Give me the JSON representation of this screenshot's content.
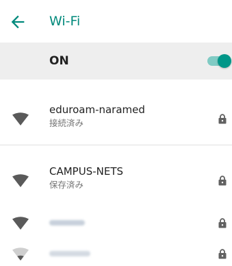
{
  "header": {
    "back_icon": "arrow-left-icon",
    "title": "Wi-Fi"
  },
  "toggle": {
    "label": "ON",
    "state": "on"
  },
  "networks": [
    {
      "name": "eduroam-naramed",
      "status": "接続済み",
      "secured": true,
      "signal": 4
    },
    {
      "name": "CAMPUS-NETS",
      "status": "保存済み",
      "secured": true,
      "signal": 4
    },
    {
      "secured": true,
      "signal": 4
    },
    {
      "secured": true,
      "signal": 1
    }
  ],
  "colors": {
    "accent": "#00897b",
    "switch_thumb": "#009688",
    "switch_track": "#80cbc4",
    "toggle_row_bg": "#eeeeee",
    "icon_dark": "#5a5a5a",
    "icon_light": "#cfcfcf"
  }
}
